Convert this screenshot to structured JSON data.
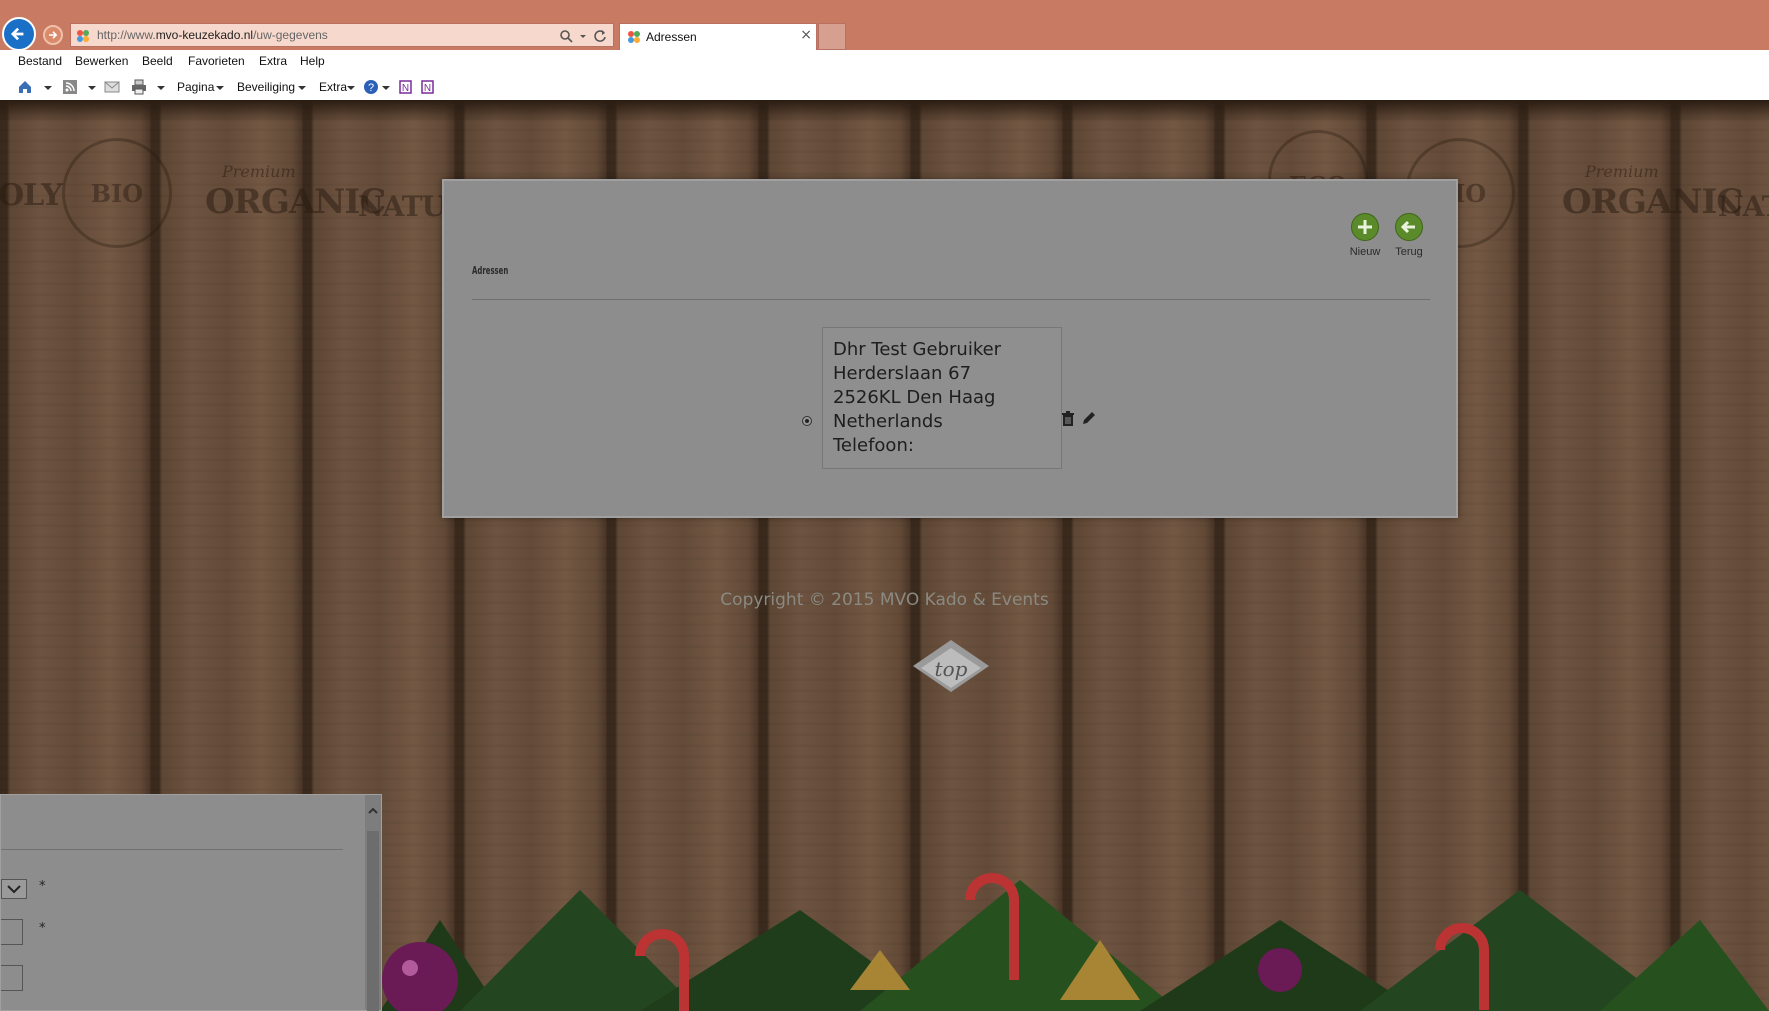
{
  "browser": {
    "url_prefix": "http://www.",
    "url_domain": "mvo-keuzekado.nl",
    "url_path": "/uw-gegevens",
    "tab_title": "Adressen",
    "tab_close": "×",
    "menu": [
      "Bestand",
      "Bewerken",
      "Beeld",
      "Favorieten",
      "Extra",
      "Help"
    ],
    "toolbar": {
      "pagina": "Pagina",
      "beveiliging": "Beveiliging",
      "extra": "Extra"
    },
    "icons": [
      "back-arrow-icon",
      "forward-arrow-icon",
      "joomla-favicon",
      "search-icon",
      "refresh-icon",
      "home-icon",
      "rss-feed-icon",
      "mail-icon",
      "print-icon",
      "help-icon",
      "onenote-icon"
    ]
  },
  "panel": {
    "title": "Adressen",
    "actions": {
      "new": "Nieuw",
      "back": "Terug"
    },
    "address": {
      "selected": true,
      "name": "Dhr Test Gebruiker",
      "street": "Herderslaan 67",
      "city": "2526KL Den Haag",
      "country": "Netherlands",
      "phone": "Telefoon:"
    }
  },
  "footer": {
    "copyright": "Copyright © 2015 MVO Kado & Events",
    "top": "top"
  },
  "side_panel": {
    "required_marker": "*"
  },
  "background_text": {
    "premium": "Premium",
    "organic": "ORGANIC",
    "natur": "NATUR",
    "bio": "BIO",
    "eco": "ECO",
    "oly": "OLY"
  },
  "colors": {
    "chrome": "#c97a62",
    "accent": "#5b8a2a",
    "back_button": "#1a6fc6"
  }
}
